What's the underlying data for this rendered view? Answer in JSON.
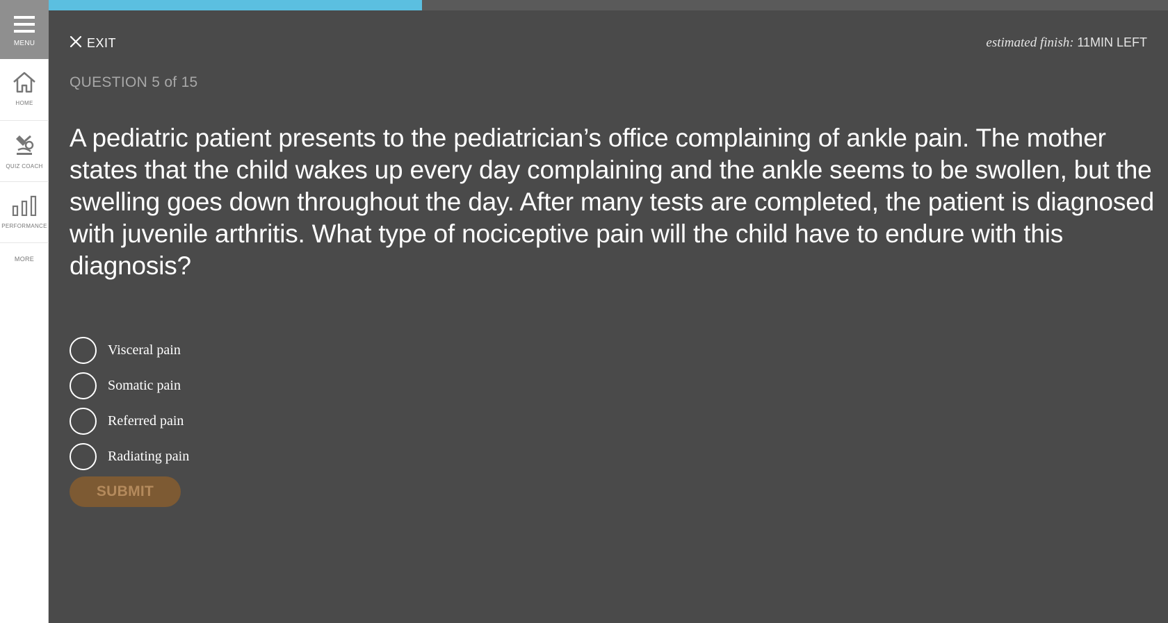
{
  "sidebar": {
    "menu_label": "MENU",
    "items": [
      {
        "label": "HOME",
        "icon": "home-icon"
      },
      {
        "label": "QUIZ COACH",
        "icon": "quiz-coach-icon"
      },
      {
        "label": "PERFORMANCE",
        "icon": "bar-chart-icon"
      }
    ],
    "more_label": "MORE"
  },
  "header": {
    "exit_label": "EXIT",
    "finish_prefix": "estimated finish:",
    "finish_value": "11MIN LEFT",
    "progress_fraction": 0.3333
  },
  "quiz": {
    "question_counter": "QUESTION 5 of 15",
    "question_text": "A pediatric patient presents to the pediatrician’s office complaining of ankle pain. The mother states that the child wakes up every day complaining and the ankle seems to be swollen, but the swelling goes down throughout the day. After many tests are completed, the patient is diagnosed with juvenile arthritis. What type of nociceptive pain will the child have to endure with this diagnosis?",
    "options": [
      {
        "label": "Visceral pain"
      },
      {
        "label": "Somatic pain"
      },
      {
        "label": "Referred pain"
      },
      {
        "label": "Radiating pain"
      }
    ],
    "submit_label": "SUBMIT"
  },
  "colors": {
    "progress": "#5bbfe0",
    "background": "#4a4a4a",
    "submit_bg": "#7d5a33",
    "submit_text": "#b48a5c",
    "menu_bg": "#8f8f8f"
  }
}
